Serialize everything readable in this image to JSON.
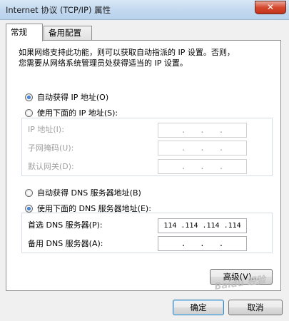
{
  "window": {
    "title": "Internet 协议 (TCP/IP) 属性",
    "close_label": "✕"
  },
  "tabs": [
    {
      "label": "常规",
      "active": true
    },
    {
      "label": "备用配置",
      "active": false
    }
  ],
  "description": [
    "如果网络支持此功能，则可以获取自动指派的 IP 设置。否则，",
    "您需要从网络系统管理员处获得适当的 IP 设置。"
  ],
  "ip_options": {
    "auto": {
      "label": "自动获得 IP 地址(O)",
      "selected": true
    },
    "manual": {
      "label": "使用下面的 IP 地址(S):",
      "selected": false
    }
  },
  "ip_fields": [
    {
      "label": "IP 地址(I):",
      "value": ".   .   .",
      "enabled": false
    },
    {
      "label": "子网掩码(U):",
      "value": ".   .   .",
      "enabled": false
    },
    {
      "label": "默认网关(D):",
      "value": ".   .   .",
      "enabled": false
    }
  ],
  "dns_options": {
    "auto": {
      "label": "自动获得 DNS 服务器地址(B)",
      "selected": false
    },
    "manual": {
      "label": "使用下面的 DNS 服务器地址(E):",
      "selected": true
    }
  },
  "dns_fields": [
    {
      "label": "首选 DNS 服务器(P):",
      "value": "114 .114 .114 .114",
      "enabled": true
    },
    {
      "label": "备用 DNS 服务器(A):",
      "value": ".   .   .",
      "enabled": true
    }
  ],
  "buttons": {
    "advanced": "高级(V)...",
    "ok": "确定",
    "cancel": "取消"
  },
  "watermark": "Baidu 经验"
}
